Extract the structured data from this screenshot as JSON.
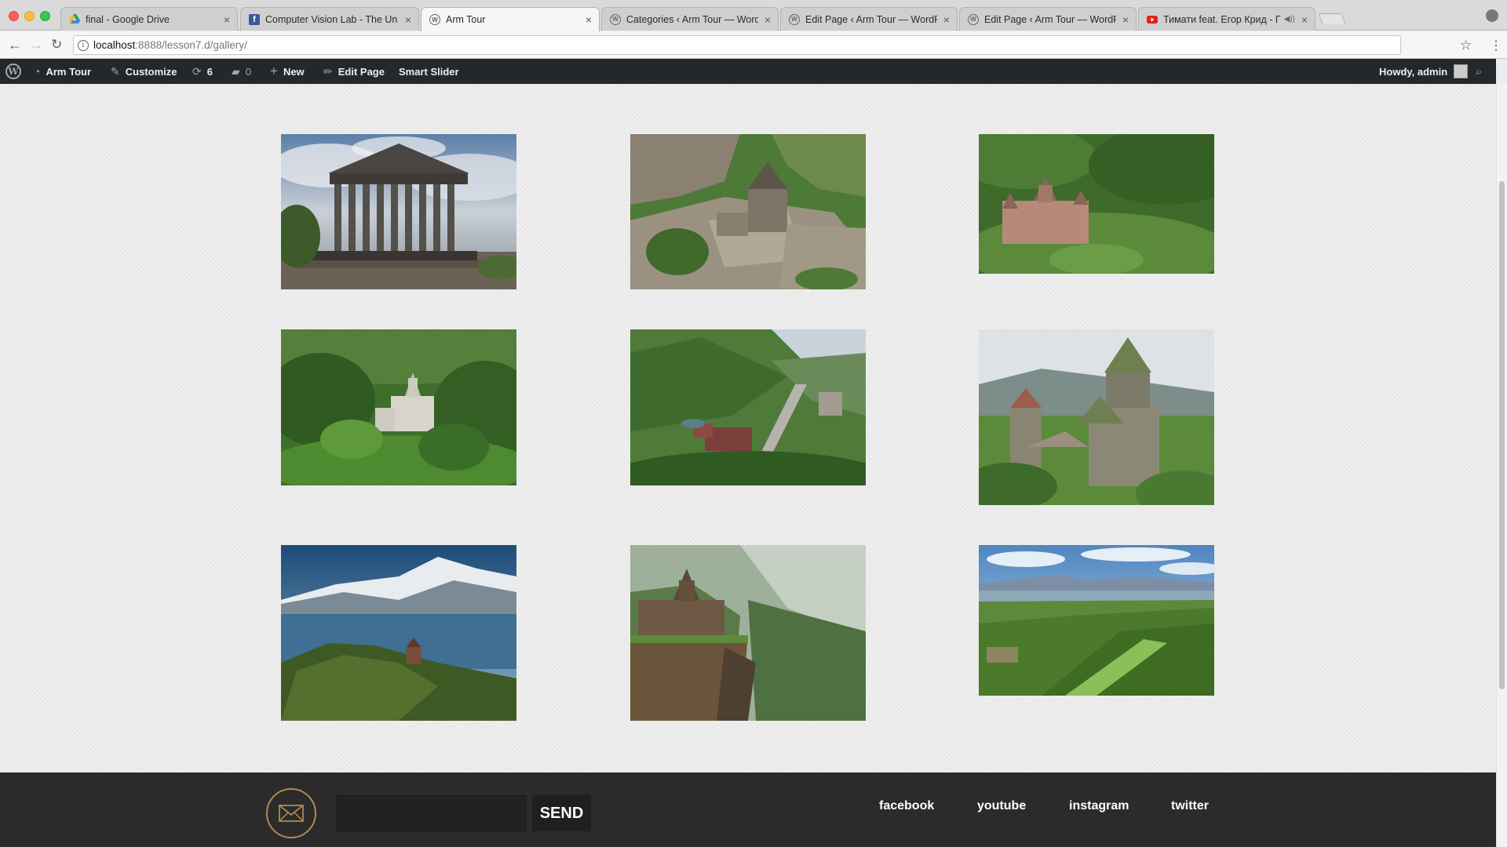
{
  "browser": {
    "tabs": [
      {
        "title": "final - Google Drive",
        "favicon": "drive-icon",
        "active": false
      },
      {
        "title": "Computer Vision Lab - The Un",
        "favicon": "facebook-icon",
        "active": false
      },
      {
        "title": "Arm Tour",
        "favicon": "wordpress-icon",
        "active": true
      },
      {
        "title": "Categories ‹ Arm Tour — Word",
        "favicon": "wordpress-icon",
        "active": false
      },
      {
        "title": "Edit Page ‹ Arm Tour — WordP",
        "favicon": "wordpress-icon",
        "active": false
      },
      {
        "title": "Edit Page ‹ Arm Tour — WordP",
        "favicon": "wordpress-icon",
        "active": false
      },
      {
        "title": "Тимати feat. Егор Крид - Г",
        "favicon": "youtube-icon",
        "active": false,
        "audio": true
      }
    ],
    "url_host": "localhost",
    "url_path": ":8888/lesson7.d/gallery/"
  },
  "admin_bar": {
    "site_name": "Arm Tour",
    "customize": "Customize",
    "updates_count": "6",
    "comments_count": "0",
    "new_label": "New",
    "edit_page": "Edit Page",
    "smart_slider": "Smart Slider",
    "howdy": "Howdy, admin"
  },
  "gallery": [
    {
      "name": "photo-garni-temple"
    },
    {
      "name": "photo-geghard-monastery"
    },
    {
      "name": "photo-haghpat-monastery"
    },
    {
      "name": "photo-haghartsin-monastery"
    },
    {
      "name": "photo-dilijan-valley"
    },
    {
      "name": "photo-akhtala-monastery"
    },
    {
      "name": "photo-sevanavank-lake"
    },
    {
      "name": "photo-tatev-monastery"
    },
    {
      "name": "photo-green-hills"
    }
  ],
  "footer": {
    "email_value": "",
    "send_label": "SEND",
    "social": [
      "facebook",
      "youtube",
      "instagram",
      "twitter"
    ]
  },
  "colors": {
    "admin_bar": "#23282d",
    "footer": "#2b2b2b",
    "mail_ring": "#b08a4f"
  }
}
